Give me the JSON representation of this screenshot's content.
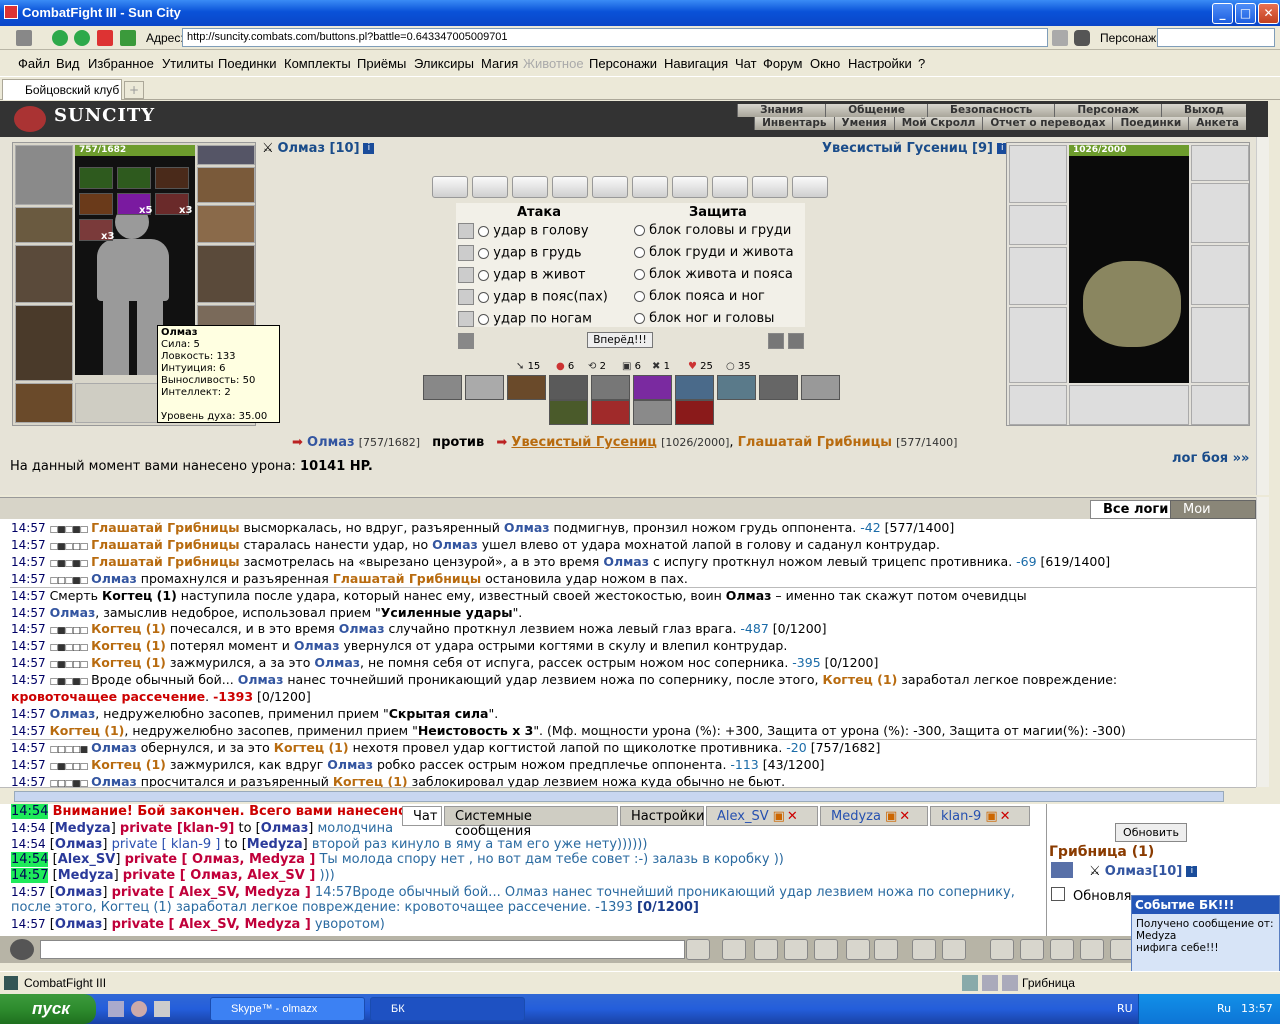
{
  "window": {
    "title": "CombatFight III - Sun City",
    "min": "_",
    "max": "□",
    "close": "✕"
  },
  "address": {
    "label": "Адрес:",
    "url": "http://suncity.combats.com/buttons.pl?battle=0.643347005009701",
    "pers_label": "Персонаж:"
  },
  "menu": [
    "Файл",
    "Вид",
    "Избранное",
    "Утилиты",
    "Поединки",
    "Комплекты",
    "Приёмы",
    "Эликсиры",
    "Магия",
    "Животное",
    "Персонажи",
    "Навигация",
    "Чат",
    "Форум",
    "Окно",
    "Настройки",
    "?"
  ],
  "tabs": {
    "active": "Бойцовский клуб",
    "add": "+"
  },
  "game_header": {
    "logo": "SUNCITY",
    "nav_top": [
      "Знания",
      "Общение",
      "Безопасность",
      "Персонаж",
      "Выход"
    ],
    "nav_bottom": [
      "Инвентарь",
      "Умения",
      "Мой Скролл",
      "Отчет о переводах",
      "Поединки",
      "Анкета"
    ]
  },
  "left_fighter": {
    "name": "Олмаз [10]",
    "hp": "757/1682",
    "counts": [
      "x5",
      "x3",
      "x3"
    ]
  },
  "tooltip": {
    "name": "Олмаз",
    "lines": [
      "Сила: 5",
      "Ловкость: 133",
      "Интуиция: 6",
      "Выносливость: 50",
      "Интеллект: 2"
    ],
    "spirit": "Уровень духа: 35.00"
  },
  "right_fighter": {
    "name": "Увесистый Гусениц [9]",
    "hp": "1026/2000"
  },
  "attack": {
    "header_attack": "Атака",
    "header_defense": "Защита",
    "attacks": [
      "удар в голову",
      "удар в грудь",
      "удар в живот",
      "удар в пояс(пах)",
      "удар по ногам"
    ],
    "defenses": [
      "блок головы и груди",
      "блок груди и живота",
      "блок живота и пояса",
      "блок пояса и ног",
      "блок ног и головы"
    ],
    "forward": "Вперёд!!!"
  },
  "skill_counts": [
    "15",
    "6",
    "2",
    "6",
    "1",
    "25",
    "35"
  ],
  "vs": {
    "left_name": "Олмаз",
    "left_hp": "[757/1682]",
    "word": "против",
    "right_name": "Увесистый Гусениц",
    "right_hp": "[1026/2000]",
    "third_name": "Глашатай Грибницы",
    "third_hp": "[577/1400]"
  },
  "damage": {
    "text": "На данный момент вами нанесено урона:",
    "value": "10141 HP."
  },
  "log_link": "лог боя »»",
  "log_tabs": [
    "Все логи",
    "Мои логи"
  ],
  "log": [
    {
      "t": "14:57",
      "sq": "□■□■□",
      "parts": [
        [
          "o",
          "Глашатай Грибницы"
        ],
        [
          "n",
          " высморкалась, но вдруг, разъяренный "
        ],
        [
          "b",
          "Олмаз"
        ],
        [
          "n",
          " подмигнув, пронзил ножом грудь оппонента. "
        ],
        [
          "d",
          "-42"
        ],
        [
          "n",
          " [577/1400]"
        ]
      ]
    },
    {
      "t": "14:57",
      "sq": "□■□□□",
      "parts": [
        [
          "o",
          "Глашатай Грибницы"
        ],
        [
          "n",
          " старалась нанести удар, но "
        ],
        [
          "b",
          "Олмаз"
        ],
        [
          "n",
          " ушел влево от удара мохнатой лапой в голову и саданул контрудар."
        ]
      ]
    },
    {
      "t": "14:57",
      "sq": "□■□■□",
      "parts": [
        [
          "o",
          "Глашатай Грибницы"
        ],
        [
          "n",
          " засмотрелась на «вырезано цензурой», а в это время "
        ],
        [
          "b",
          "Олмаз"
        ],
        [
          "n",
          " с испугу проткнул ножом левый трицепс противника. "
        ],
        [
          "d",
          "-69"
        ],
        [
          "n",
          " [619/1400]"
        ]
      ]
    },
    {
      "t": "14:57",
      "sq": "□□□■□",
      "parts": [
        [
          "b",
          "Олмаз"
        ],
        [
          "n",
          " промахнулся и разъяренная "
        ],
        [
          "o",
          "Глашатай Грибницы"
        ],
        [
          "n",
          " остановила удар ножом в пах."
        ]
      ]
    },
    {
      "t": "14:57",
      "sq": "",
      "parts": [
        [
          "n",
          "Смерть "
        ],
        [
          "bb",
          "Когтец (1)"
        ],
        [
          "n",
          " наступила после удара, который нанес ему, известный своей жестокостью, воин "
        ],
        [
          "bb",
          "Олмаз"
        ],
        [
          "n",
          " – именно так скажут потом очевидцы"
        ]
      ]
    },
    {
      "t": "14:57",
      "sq": "",
      "parts": [
        [
          "b",
          "Олмаз"
        ],
        [
          "n",
          ", замыслив недоброе, использовал прием \""
        ],
        [
          "bb",
          "Усиленные удары"
        ],
        [
          "n",
          "\"."
        ]
      ]
    },
    {
      "t": "14:57",
      "sq": "□■□□□",
      "parts": [
        [
          "o",
          "Когтец (1)"
        ],
        [
          "n",
          " почесался, и в это время "
        ],
        [
          "b",
          "Олмаз"
        ],
        [
          "n",
          " случайно проткнул лезвием ножа левый глаз врага. "
        ],
        [
          "d",
          "-487"
        ],
        [
          "n",
          " [0/1200]"
        ]
      ]
    },
    {
      "t": "14:57",
      "sq": "□■□□□",
      "parts": [
        [
          "o",
          "Когтец (1)"
        ],
        [
          "n",
          " потерял момент и "
        ],
        [
          "b",
          "Олмаз"
        ],
        [
          "n",
          " увернулся от удара острыми когтями в скулу и влепил контрудар."
        ]
      ]
    },
    {
      "t": "14:57",
      "sq": "□■□□□",
      "parts": [
        [
          "o",
          "Когтец (1)"
        ],
        [
          "n",
          " зажмурился, а за это "
        ],
        [
          "b",
          "Олмаз"
        ],
        [
          "n",
          ", не помня себя от испуга, рассек острым ножом нос соперника. "
        ],
        [
          "d",
          "-395"
        ],
        [
          "n",
          " [0/1200]"
        ]
      ]
    },
    {
      "t": "14:57",
      "sq": "□■□■□",
      "parts": [
        [
          "n",
          "Вроде обычный бой... "
        ],
        [
          "b",
          "Олмаз"
        ],
        [
          "n",
          " нанес точнейший проникающий удар лезвием ножа по сопернику, после этого, "
        ],
        [
          "o",
          "Когтец (1)"
        ],
        [
          "n",
          " заработал легкое повреждение:"
        ]
      ]
    },
    {
      "t": "",
      "sq": "",
      "parts": [
        [
          "r",
          "кровоточащее рассечение"
        ],
        [
          "n",
          ". "
        ],
        [
          "r",
          "-1393"
        ],
        [
          "n",
          " [0/1200]"
        ]
      ]
    },
    {
      "t": "14:57",
      "sq": "",
      "parts": [
        [
          "b",
          "Олмаз"
        ],
        [
          "n",
          ", недружелюбно засопев, применил прием \""
        ],
        [
          "bb",
          "Скрытая сила"
        ],
        [
          "n",
          "\"."
        ]
      ]
    },
    {
      "t": "14:57",
      "sq": "",
      "parts": [
        [
          "o",
          "Когтец (1)"
        ],
        [
          "n",
          ", недружелюбно засопев, применил прием \""
        ],
        [
          "bb",
          "Неистовость x 3"
        ],
        [
          "n",
          "\". (Мф. мощности урона (%): +300, Защита от урона (%): -300, Защита от магии(%): -300)"
        ]
      ]
    },
    {
      "t": "14:57",
      "sq": "□□□□■",
      "parts": [
        [
          "b",
          "Олмаз"
        ],
        [
          "n",
          " обернулся, и за это "
        ],
        [
          "o",
          "Когтец (1)"
        ],
        [
          "n",
          " нехотя провел удар когтистой лапой по щиколотке противника. "
        ],
        [
          "d",
          "-20"
        ],
        [
          "n",
          " [757/1682]"
        ]
      ]
    },
    {
      "t": "14:57",
      "sq": "□■□□□",
      "parts": [
        [
          "o",
          "Когтец (1)"
        ],
        [
          "n",
          " зажмурился, как вдруг "
        ],
        [
          "b",
          "Олмаз"
        ],
        [
          "n",
          " робко рассек острым ножом предплечье оппонента. "
        ],
        [
          "d",
          "-113"
        ],
        [
          "n",
          " [43/1200]"
        ]
      ]
    },
    {
      "t": "14:57",
      "sq": "□□□■□",
      "parts": [
        [
          "b",
          "Олмаз"
        ],
        [
          "n",
          " просчитался и разъяренный "
        ],
        [
          "o",
          "Когтец (1)"
        ],
        [
          "n",
          " заблокировал удар лезвием ножа куда обычно не бьют."
        ]
      ]
    }
  ],
  "chat_tabs": [
    "Чат",
    "Системные сообщения",
    "Настройки",
    "Alex_SV",
    "Medyza",
    "klan-9"
  ],
  "chat": [
    {
      "t": "14:54",
      "parts": [
        [
          "r",
          "Внимание! Бой закончен. Всего вами нанесено ур"
        ]
      ]
    },
    {
      "t": "14:54",
      "parts": [
        [
          "n",
          "["
        ],
        [
          "k",
          "Medyza"
        ],
        [
          "n",
          "] "
        ],
        [
          "p",
          "private [klan-9]"
        ],
        [
          "n",
          " to ["
        ],
        [
          "k",
          "Олмаз"
        ],
        [
          "n",
          "] "
        ],
        [
          "m",
          "молодчина"
        ]
      ]
    },
    {
      "t": "14:54",
      "parts": [
        [
          "n",
          "["
        ],
        [
          "k",
          "Олмаз"
        ],
        [
          "n",
          "] "
        ],
        [
          "u",
          "private [ klan-9 ]"
        ],
        [
          "n",
          " to ["
        ],
        [
          "k",
          "Medyza"
        ],
        [
          "n",
          "] "
        ],
        [
          "m",
          "второй раз кинуло в яму а там его уже нету))))))"
        ]
      ]
    },
    {
      "t": "14:54",
      "parts": [
        [
          "n",
          "["
        ],
        [
          "k",
          "Alex_SV"
        ],
        [
          "n",
          "] "
        ],
        [
          "p",
          "private [ Олмаз, Medyza ]"
        ],
        [
          "n",
          " "
        ],
        [
          "m",
          "Ты молода спору нет , но вот дам тебе совет :-) залазь в коробку ))"
        ]
      ]
    },
    {
      "t": "14:57",
      "parts": [
        [
          "n",
          "["
        ],
        [
          "k",
          "Medyza"
        ],
        [
          "n",
          "] "
        ],
        [
          "p",
          "private [ Олмаз, Alex_SV ]"
        ],
        [
          "n",
          " "
        ],
        [
          "m",
          ")))"
        ]
      ]
    },
    {
      "t": "14:57",
      "parts": [
        [
          "n",
          "["
        ],
        [
          "k",
          "Олмаз"
        ],
        [
          "n",
          "] "
        ],
        [
          "p",
          "private [ Alex_SV, Medyza ]"
        ],
        [
          "n",
          " "
        ],
        [
          "m",
          "14:57Вроде обычный бой... Олмаз нанес точнейший проникающий удар лезвием ножа по сопернику,"
        ]
      ]
    },
    {
      "t": "",
      "parts": [
        [
          "m",
          "после этого, Когтец (1) заработал легкое повреждение: кровоточащее рассечение. -1393 "
        ],
        [
          "k",
          "[0/1200]"
        ]
      ]
    },
    {
      "t": "14:57",
      "parts": [
        [
          "n",
          "["
        ],
        [
          "k",
          "Олмаз"
        ],
        [
          "n",
          "] "
        ],
        [
          "p",
          "private [ Alex_SV, Medyza ]"
        ],
        [
          "n",
          " "
        ],
        [
          "m",
          "уворотом)"
        ]
      ]
    }
  ],
  "right_panel": {
    "update": "Обновить",
    "location": "Грибница (1)",
    "player": "Олмаз[10]",
    "auto": "Обновля"
  },
  "notification": {
    "title": "Событие БК!!!",
    "line1": "Получено сообщение от:",
    "line2": "Medyza",
    "line3": "нифига себе!!!"
  },
  "status": {
    "title": "CombatFight III",
    "location": "Грибница"
  },
  "taskbar": {
    "start": "пуск",
    "tasks": [
      "Skype™ - olmazx",
      "БК"
    ],
    "lang": "RU",
    "lang2": "Ru",
    "time": "13:57"
  }
}
